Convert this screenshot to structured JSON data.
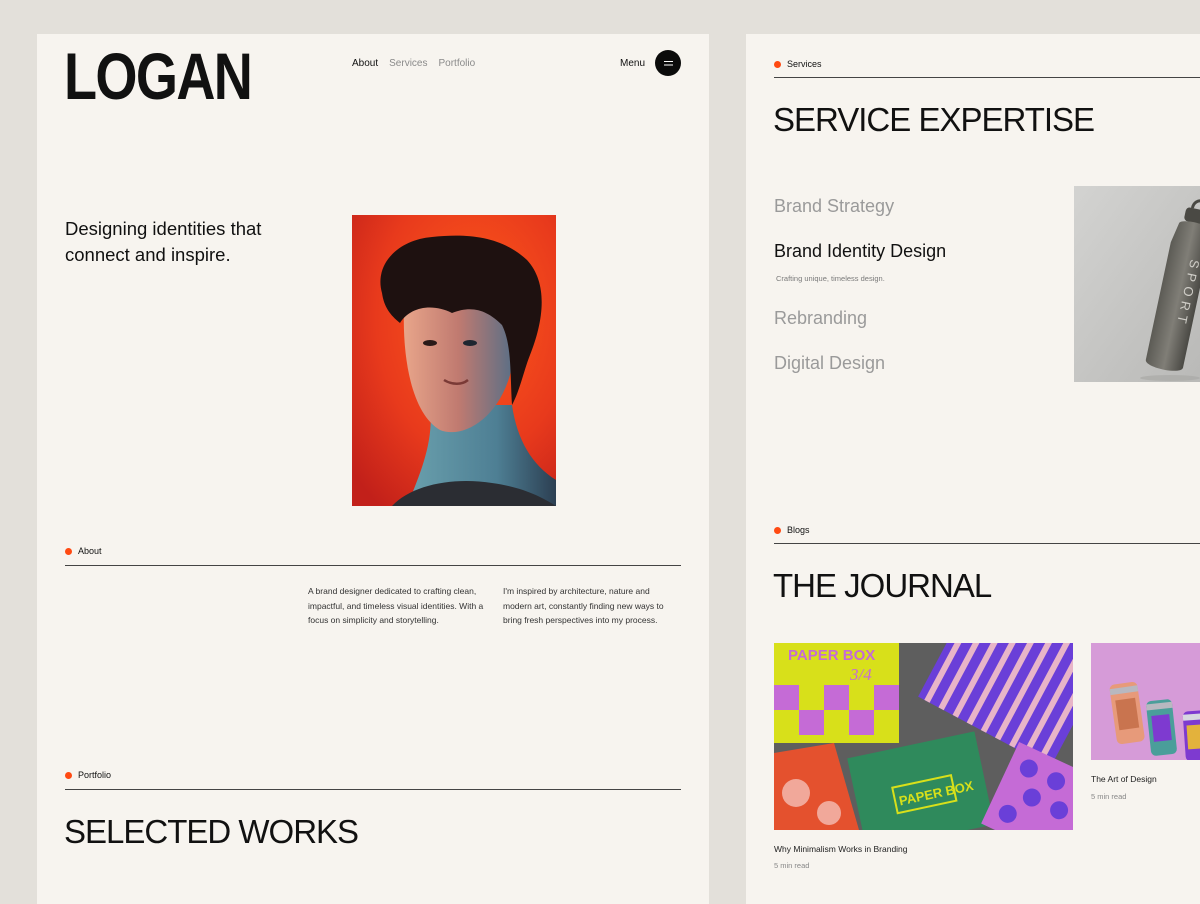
{
  "left": {
    "logo": "LOGAN",
    "nav": [
      "About",
      "Services",
      "Portfolio"
    ],
    "menu_label": "Menu",
    "hero_text": "Designing identities that connect and inspire.",
    "about": {
      "label": "About",
      "paragraph_1": "A brand designer dedicated to crafting clean, impactful, and timeless visual identities. With a focus on simplicity and storytelling.",
      "paragraph_2": "I'm inspired by architecture, nature and modern art, constantly finding new ways to bring fresh perspectives into my process."
    },
    "portfolio": {
      "label": "Portfolio",
      "title": "SELECTED WORKS"
    }
  },
  "right": {
    "services": {
      "label": "Services",
      "title": "SERVICE EXPERTISE",
      "items": [
        "Brand Strategy",
        "Brand Identity Design",
        "Rebranding",
        "Digital Design"
      ],
      "active_description": "Crafting unique, timeless design.",
      "bottle_text": "SPORT"
    },
    "blogs": {
      "label": "Blogs",
      "title": "THE JOURNAL",
      "posts": [
        {
          "title": "Why Minimalism Works in Branding",
          "meta": "5 min read",
          "box_text": "PAPER BOX",
          "box_sub": "3/4"
        },
        {
          "title": "The Art of Design",
          "meta": "5 min read"
        }
      ]
    }
  },
  "colors": {
    "accent": "#ff4a12",
    "page_bg": "#f7f4ef",
    "canvas_bg": "#e3e0da"
  }
}
